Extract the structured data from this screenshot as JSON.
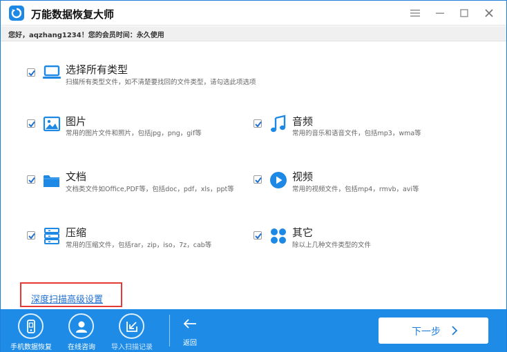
{
  "window": {
    "title": "万能数据恢复大师",
    "greeting": "您好，aqzhang1234！您的会员时间：永久使用"
  },
  "options": [
    {
      "key": "all",
      "title": "选择所有类型",
      "desc": "扫描所有类型文件，如不清楚要找回的文件类型，请勾选此项选项",
      "checked": true,
      "icon": "laptop-icon"
    },
    {
      "key": "images",
      "title": "图片",
      "desc": "常用的图片文件和照片，包括jpg，png，gif等",
      "checked": true,
      "icon": "image-icon"
    },
    {
      "key": "audio",
      "title": "音频",
      "desc": "常用的音乐和语音文件，包括mp3，wma等",
      "checked": true,
      "icon": "music-note-icon"
    },
    {
      "key": "docs",
      "title": "文档",
      "desc": "文档类文件如Office,PDF等，包括doc，pdf，xls，ppt等",
      "checked": true,
      "icon": "folder-icon"
    },
    {
      "key": "video",
      "title": "视频",
      "desc": "常用的视频文件，包括mp4，rmvb，avi等",
      "checked": true,
      "icon": "play-icon"
    },
    {
      "key": "archive",
      "title": "压缩",
      "desc": "常用的压缩文件，包括rar，zip，iso，7z，cab等",
      "checked": true,
      "icon": "archive-icon"
    },
    {
      "key": "other",
      "title": "其它",
      "desc": "除以上几种文件类型的文件",
      "checked": true,
      "icon": "grid-icon"
    }
  ],
  "advanced_link": "深度扫描高级设置",
  "bottom": {
    "items": [
      {
        "label": "手机数据恢复",
        "icon": "phone-icon"
      },
      {
        "label": "在线咨询",
        "icon": "user-icon"
      },
      {
        "label": "导入扫描记录",
        "icon": "import-icon"
      }
    ],
    "back_label": "返回",
    "next_label": "下一步"
  },
  "colors": {
    "accent": "#1e8ce6",
    "icon_blue": "#1e88e5",
    "highlight_red": "#e53935"
  }
}
